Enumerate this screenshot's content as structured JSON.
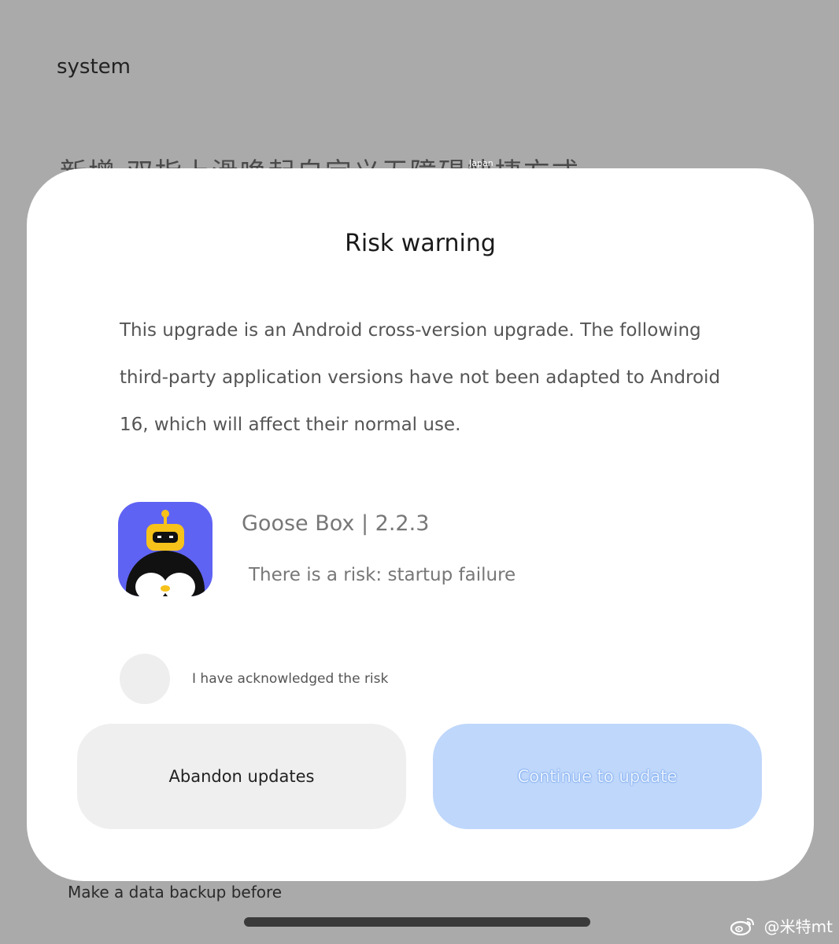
{
  "background": {
    "title": "system",
    "chinese_line": "新增 双指上滑唤起自定义无障碍快捷方式",
    "location_tag": "Japan",
    "backup_text": "Make a data backup before"
  },
  "dialog": {
    "title": "Risk warning",
    "message": "This upgrade is an Android cross-version upgrade. The following third-party application versions have not been adapted to Android 16, which will affect their normal use.",
    "app": {
      "name": "Goose Box | 2.2.3",
      "risk": "There is a risk: startup failure",
      "icon": "goose-box-app-icon"
    },
    "acknowledge_label": "I have acknowledged the risk",
    "buttons": {
      "abandon": "Abandon updates",
      "continue": "Continue to update"
    }
  },
  "watermark": {
    "text": "@米特mt",
    "icon": "weibo-icon"
  },
  "colors": {
    "overlay": "#aaaaaa",
    "dialog": "#ffffff",
    "abandon_button": "#efefef",
    "continue_button": "#bfd7fb",
    "app_icon_bg": "#5f63f3"
  }
}
